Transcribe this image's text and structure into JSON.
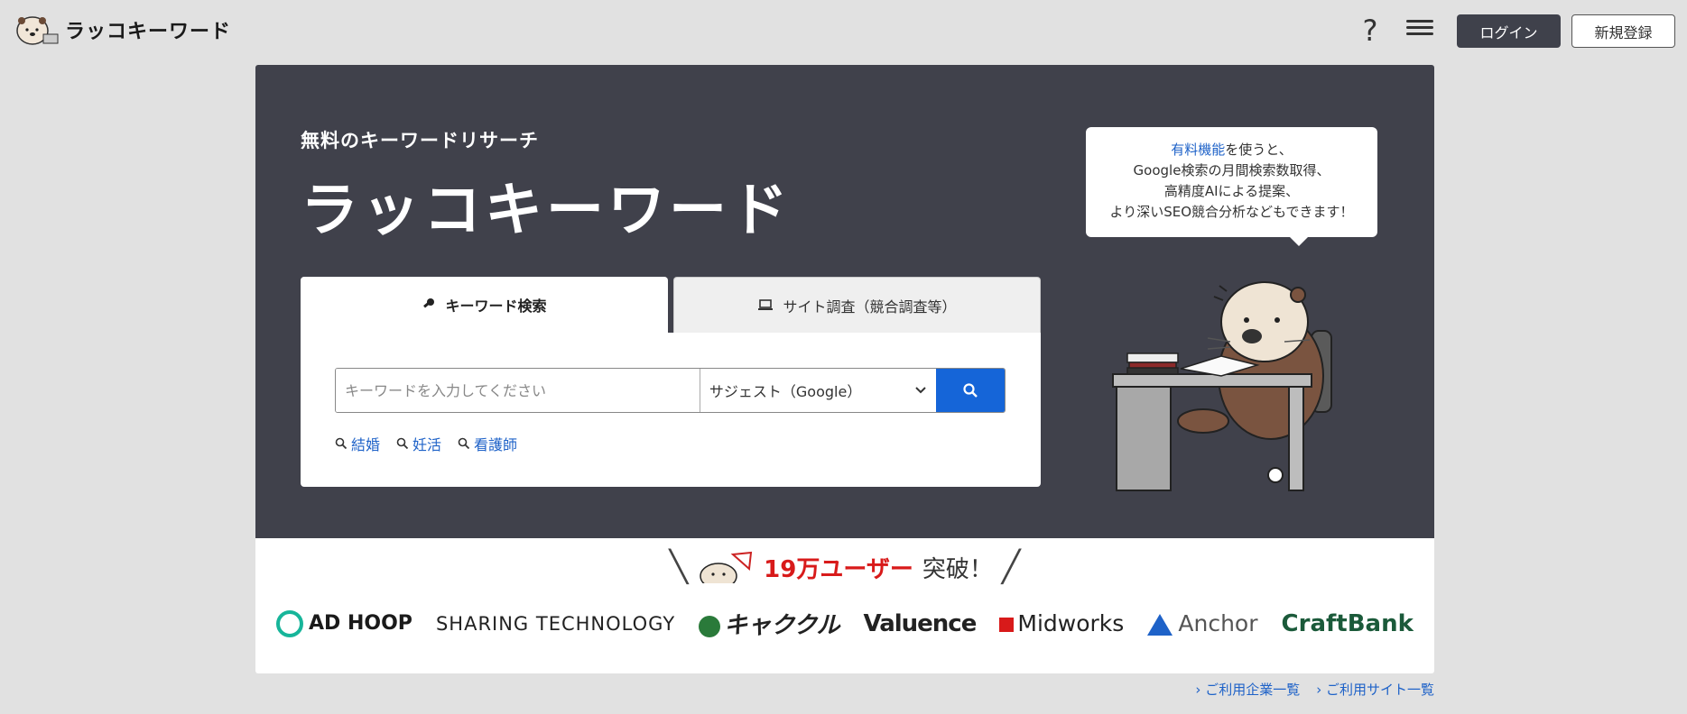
{
  "header": {
    "logo_text": "ラッコキーワード",
    "help_label": "?",
    "login_label": "ログイン",
    "register_label": "新規登録"
  },
  "hero": {
    "subtitle": "無料のキーワードリサーチ",
    "title": "ラッコキーワード",
    "bubble": {
      "link_text": "有料機能",
      "line1_rest": "を使うと、",
      "line2": "Google検索の月間検索数取得、",
      "line3": "高精度AIによる提案、",
      "line4": "より深いSEO競合分析などもできます！"
    }
  },
  "search": {
    "tabs": [
      {
        "label": "キーワード検索",
        "icon": "key-icon",
        "active": true
      },
      {
        "label": "サイト調査（競合調査等）",
        "icon": "laptop-icon",
        "active": false
      }
    ],
    "placeholder": "キーワードを入力してください",
    "mode": "サジェスト（Google）",
    "suggestions": [
      "結婚",
      "妊活",
      "看護師"
    ]
  },
  "users": {
    "count": "19万ユーザー",
    "suffix": "突破！",
    "clients": [
      "AD HOOP",
      "SHARING TECHNOLOGY",
      "キャククル",
      "Valuence",
      "Midworks",
      "Anchor",
      "CraftBank"
    ]
  },
  "footer": {
    "company_link": "ご利用企業一覧",
    "site_link": "ご利用サイト一覧"
  },
  "colors": {
    "hero_bg": "#40414b",
    "accent_blue": "#1565d8",
    "link_blue": "#1e62c8",
    "count_red": "#d81a1a"
  }
}
